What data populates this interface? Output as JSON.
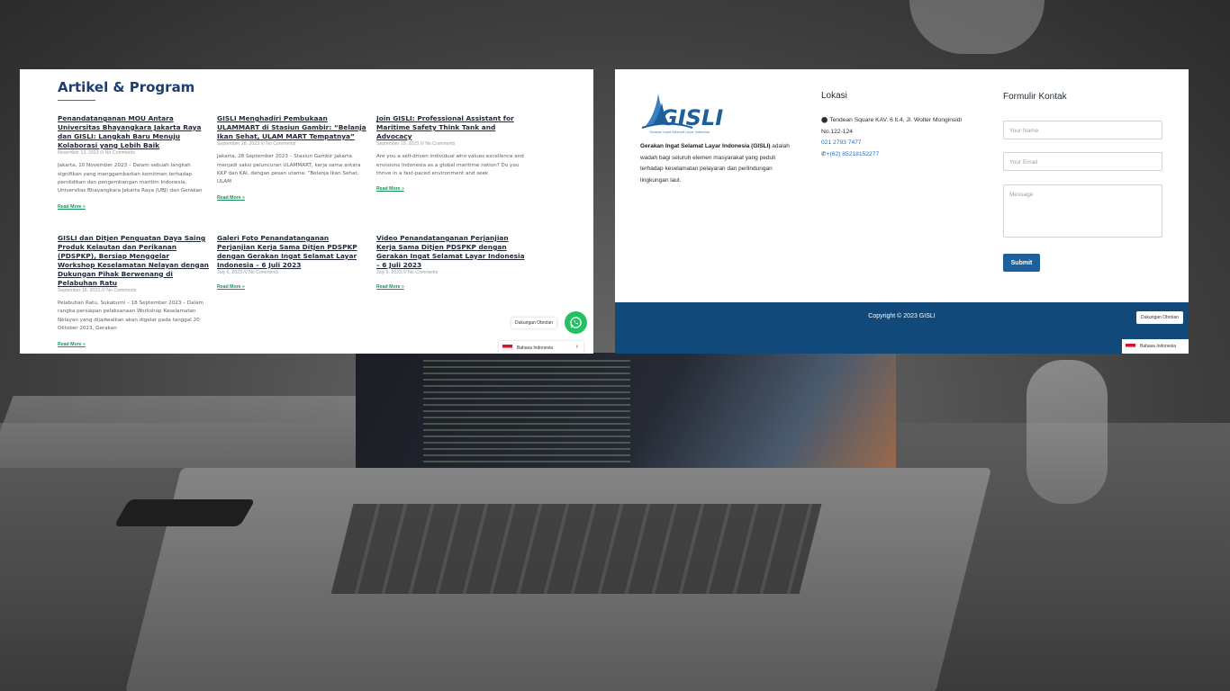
{
  "articles_panel": {
    "title": "Artikel & Program",
    "articles": [
      {
        "title": "Penandatanganan MOU Antara Universitas Bhayangkara Jakarta Raya dan GISLI: Langkah Baru Menuju Kolaborasi yang Lebih Baik",
        "meta": "November 13, 2023 /// No Comments",
        "excerpt": "Jakarta, 10 November 2023 – Dalam sebuah langkah signifikan yang menggambarkan komitmen terhadap pendidikan dan pengembangan maritim Indonesia, Universitas Bhayangkara Jakarta Raya (UBJ) dan Gerakan",
        "read_more": "Read More »"
      },
      {
        "title": "GISLI Menghadiri Pembukaan ULAMMART di Stasiun Gambir: “Belanja Ikan Sehat, ULAM MART Tempatnya”",
        "meta": "September 28, 2023 /// No Comments",
        "excerpt": "Jakarta, 28 September 2023 – Stasiun Gambir Jakarta menjadi saksi peluncuran ULAMMART, kerja sama antara KKP dan KAI, dengan pesan utama: “Belanja Ikan Sehat, ULAM",
        "read_more": "Read More »"
      },
      {
        "title": "Join GISLI: Professional Assistant for Maritime Safety Think Tank and Advocacy",
        "meta": "September 19, 2023 /// No Comments",
        "excerpt": "Are you a self-driven individual who values excellence and envisions Indonesia as a global maritime nation? Do you thrive in a fast-paced environment and seek",
        "read_more": "Read More »"
      },
      {
        "title": "GISLI dan Ditjen Penguatan Daya Saing Produk Kelautan dan Perikanan (PDSPKP), Bersiap Menggelar Workshop Keselamatan Nelayan dengan Dukungan Pihak Berwenang di Pelabuhan Ratu",
        "meta": "September 18, 2023 /// No Comments",
        "excerpt": "Pelabuhan Ratu, Sukabumi – 18 September 2023 – Dalam rangka persiapan pelaksanaan Workshop Keselamatan Nelayan yang dijadwalkan akan digelar pada tanggal 20 Oktober 2023, Gerakan",
        "read_more": "Read More »"
      },
      {
        "title": "Galeri Foto Penandatanganan Perjanjian Kerja Sama Ditjen PDSPKP dengan Gerakan Ingat Selamat Layar Indonesia – 6 Juli 2023",
        "meta": "July 6, 2023 /// No Comments",
        "excerpt": "",
        "read_more": "Read More »"
      },
      {
        "title": "Video Penandatanganan Perjanjian Kerja Sama Ditjen PDSPKP dengan Gerakan Ingat Selamat Layar Indonesia – 6 Juli 2023",
        "meta": "July 6, 2023 /// No Comments",
        "excerpt": "",
        "read_more": "Read More »"
      }
    ],
    "chat_label": "Dukungan Obrolan",
    "language": "Bahasa Indonesia"
  },
  "footer_panel": {
    "logo_text": "GISLI",
    "logo_tagline": "Gerakan Ingat Selamat Layar Indonesia",
    "about_bold": "Gerakan Ingat Selamat Layar Indonesia (GISLI)",
    "about_rest": " adalah wadah bagi seluruh elemen masyarakat yang peduli terhadap  keselamatan pelayaran dan perlindungan lingkungan laut.",
    "lokasi_title": "Lokasi",
    "address": "Tendean Square KAV. 6 lt.4, Jl. Wolter Monginsidi No.122-124",
    "phone": "021 2793 7477",
    "whatsapp": "+(62) 85218152277",
    "form_title": "Formulir Kontak",
    "name_placeholder": "Your Name",
    "email_placeholder": "Your Email",
    "message_placeholder": "Message",
    "submit_label": "Submit",
    "copyright": "Copyright © 2023 GISLI",
    "chat_label": "Dukungan Obrolan",
    "language": "Bahasa Indonesia"
  },
  "colors": {
    "brand_blue": "#1c5f99",
    "footer_blue": "#114a7a",
    "heading_blue": "#1b3f73",
    "accent_green": "#1f8e5f",
    "whatsapp_green": "#25c064"
  }
}
